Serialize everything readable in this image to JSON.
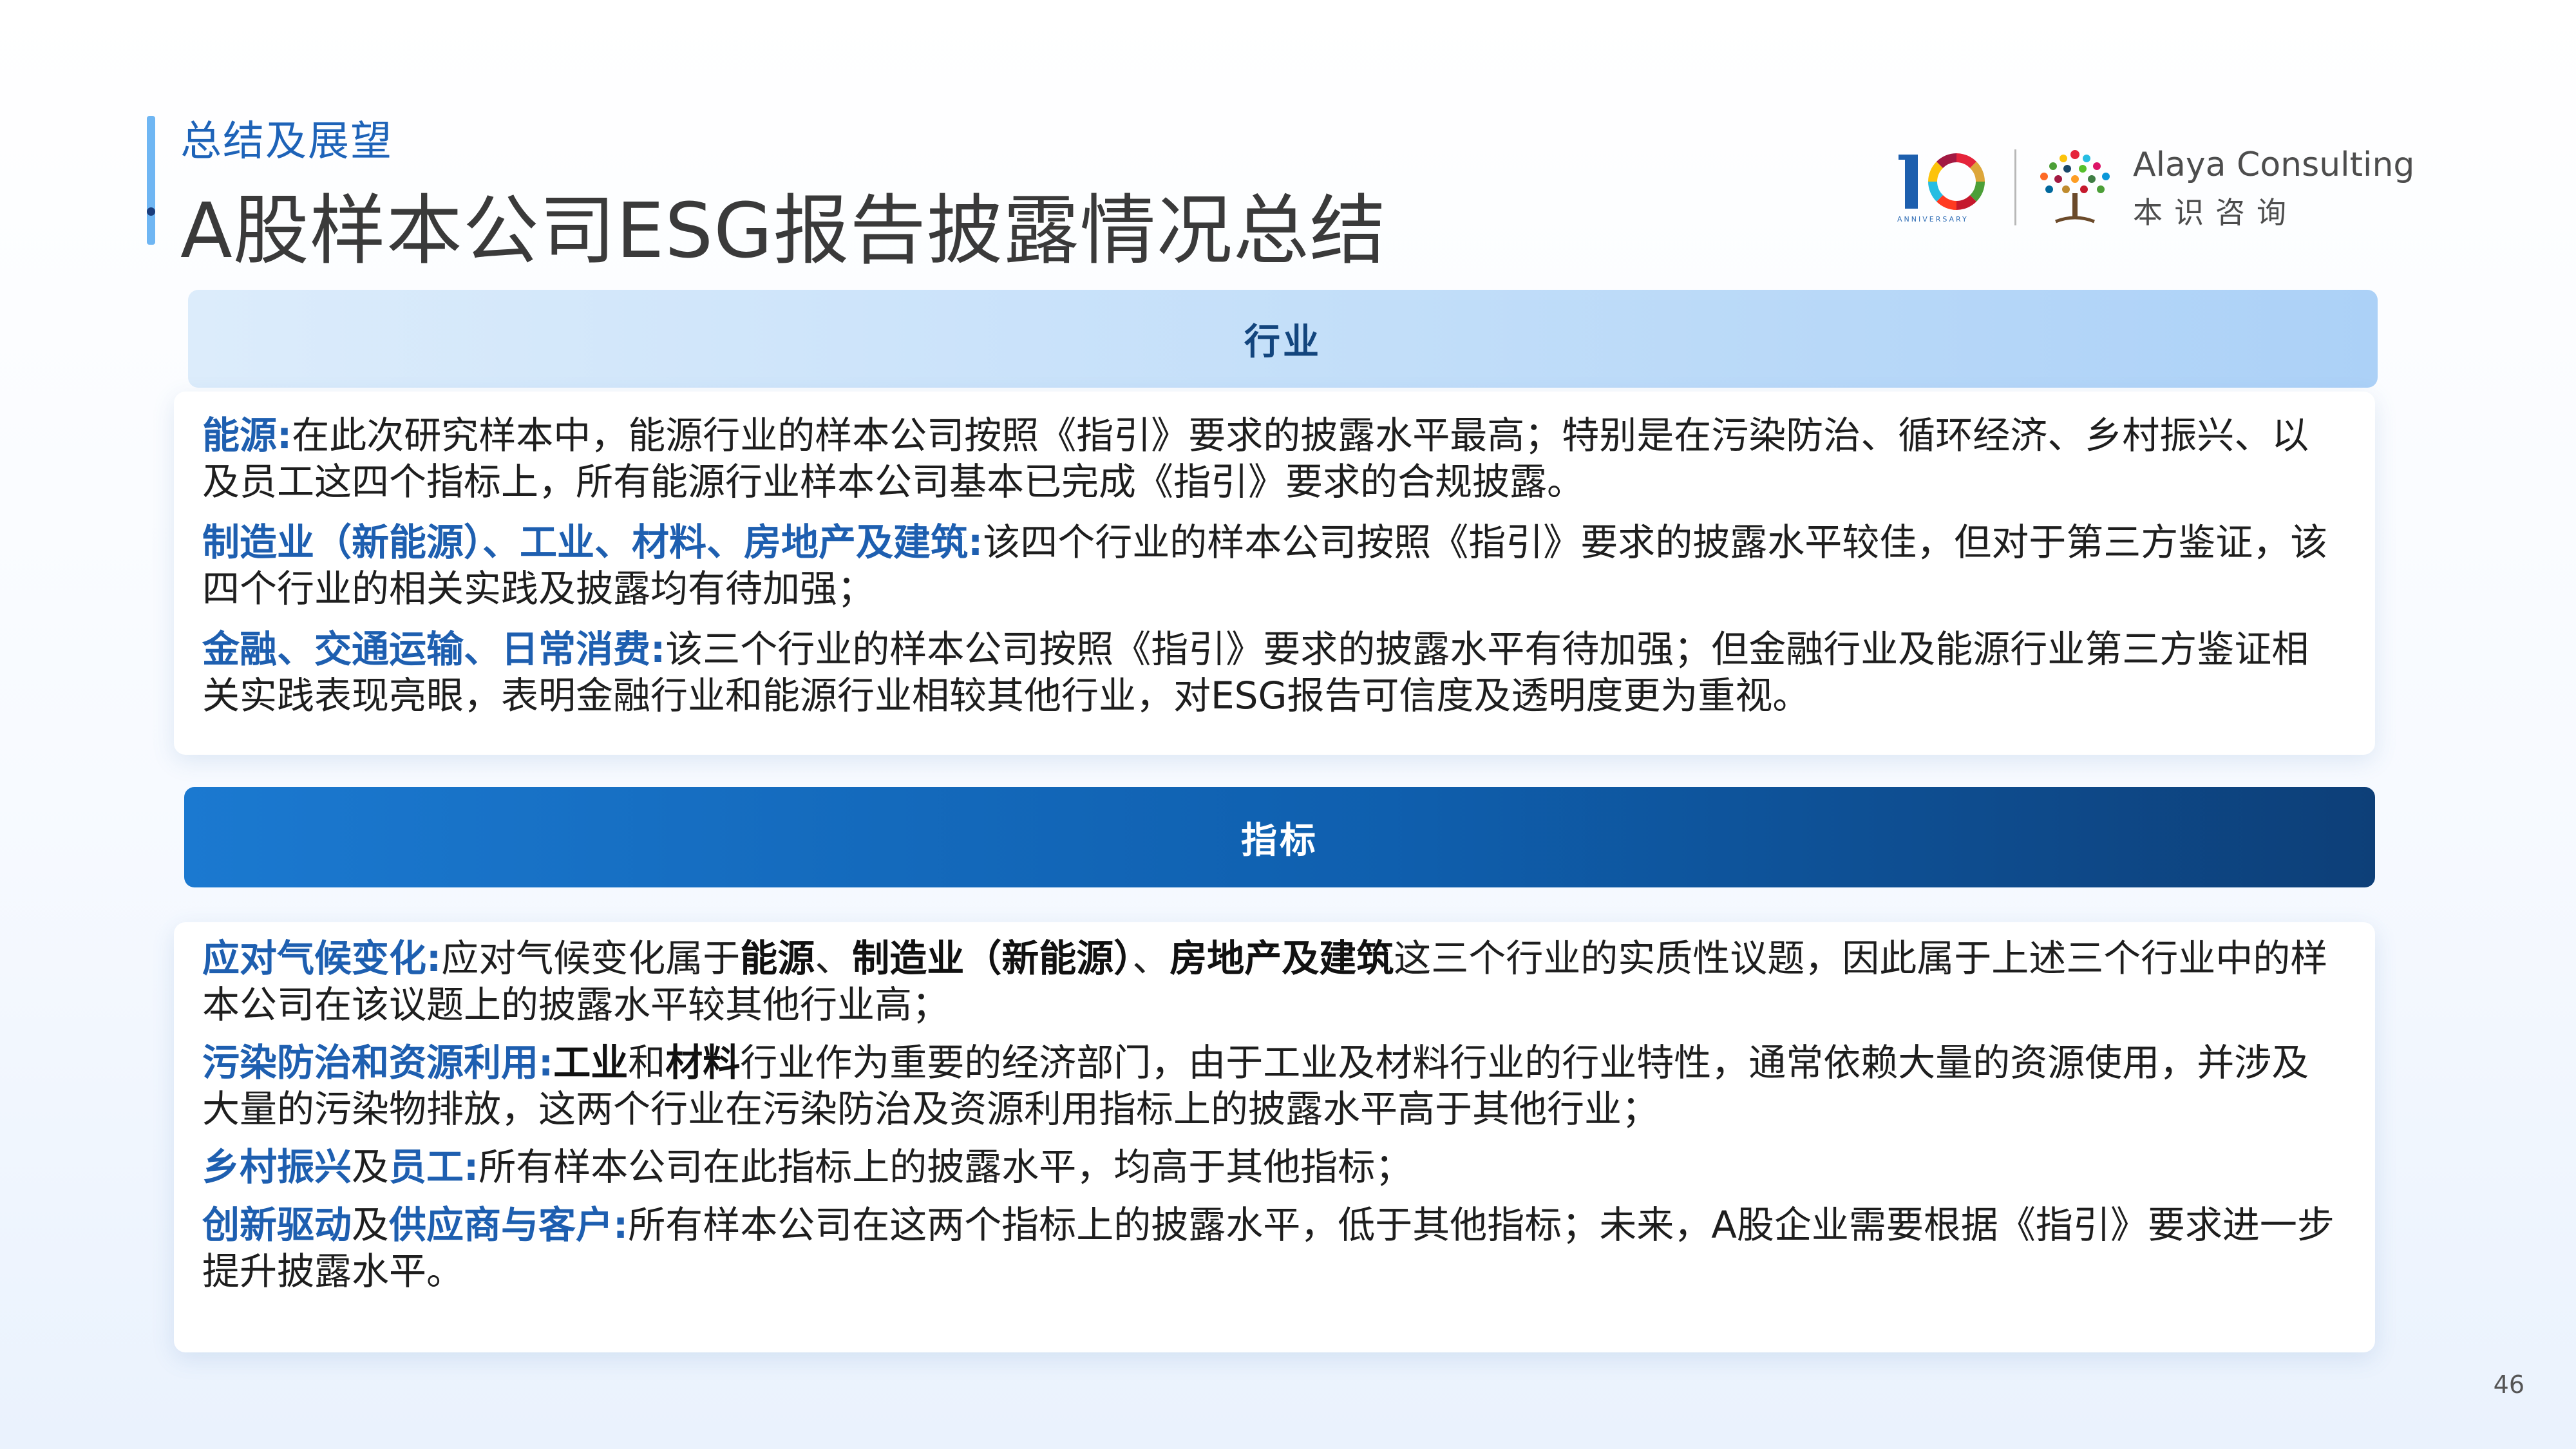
{
  "header": {
    "kicker": "总结及展望",
    "title": "A股样本公司ESG报告披露情况总结"
  },
  "logo": {
    "anniversary_number": "10",
    "anniversary_text": "ANNIVERSARY",
    "brand_en": "Alaya Consulting",
    "brand_cn": "本识咨询"
  },
  "sections": {
    "industry": {
      "header": "行业",
      "paragraphs": {
        "energy": {
          "label": "能源:",
          "text": "在此次研究样本中，能源行业的样本公司按照《指引》要求的披露水平最高；特别是在污染防治、循环经济、乡村振兴、以及员工这四个指标上，所有能源行业样本公司基本已完成《指引》要求的合规披露。"
        },
        "manufacturing": {
          "label": "制造业（新能源）、工业、材料、房地产及建筑:",
          "text": "该四个行业的样本公司按照《指引》要求的披露水平较佳，但对于第三方鉴证，该四个行业的相关实践及披露均有待加强；"
        },
        "finance": {
          "label": "金融、交通运输、日常消费:",
          "text": "该三个行业的样本公司按照《指引》要求的披露水平有待加强；但金融行业及能源行业第三方鉴证相关实践表现亮眼，表明金融行业和能源行业相较其他行业，对ESG报告可信度及透明度更为重视。"
        }
      }
    },
    "indicator": {
      "header": "指标",
      "paragraphs": {
        "climate": {
          "label": "应对气候变化:",
          "t1": "应对气候变化属于",
          "e1": "能源",
          "t2": "、",
          "e2": "制造业（新能源）",
          "t3": "、",
          "e3": "房地产及建筑",
          "t4": "这三个行业的实质性议题，因此属于上述三个行业中的样本公司在该议题上的披露水平较其他行业高；"
        },
        "pollution": {
          "label": "污染防治和资源利用:",
          "e1": "工业",
          "t1": "和",
          "e2": "材料",
          "t2": "行业作为重要的经济部门，由于工业及材料行业的行业特性，通常依赖大量的资源使用，并涉及大量的污染物排放，这两个行业在污染防治及资源利用指标上的披露水平高于其他行业；"
        },
        "rural": {
          "label1": "乡村振兴",
          "mid": "及",
          "label2": "员工:",
          "text": "所有样本公司在此指标上的披露水平，均高于其他指标；"
        },
        "innovation": {
          "label1": "创新驱动",
          "mid": "及",
          "label2": "供应商与客户:",
          "text": "所有样本公司在这两个指标上的披露水平，低于其他指标；未来，A股企业需要根据《指引》要求进一步提升披露水平。"
        }
      }
    }
  },
  "page_number": "46",
  "colors": {
    "accent_blue": "#1e5fb0",
    "kicker_blue": "#1e63b8",
    "dark_header": "#0f5fae",
    "light_header": "#c2def9"
  }
}
